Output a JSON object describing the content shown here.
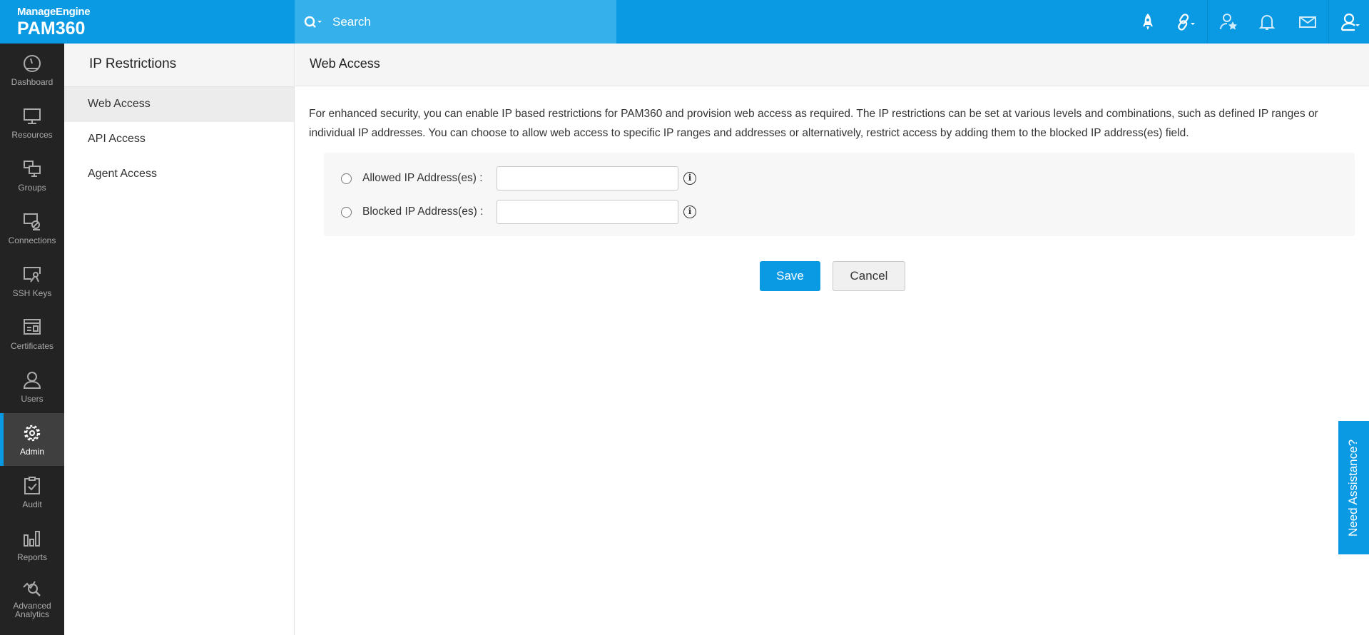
{
  "header": {
    "brand": "ManageEngine",
    "product": "PAM360",
    "search_placeholder": "Search"
  },
  "topbar_icons": [
    "rocket-icon",
    "link-icon",
    "user-star-icon",
    "bell-icon",
    "mail-icon",
    "user-icon"
  ],
  "sidebar": {
    "items": [
      {
        "label": "Dashboard",
        "icon": "dashboard-icon"
      },
      {
        "label": "Resources",
        "icon": "monitor-icon"
      },
      {
        "label": "Groups",
        "icon": "groups-icon"
      },
      {
        "label": "Connections",
        "icon": "connections-icon"
      },
      {
        "label": "SSH Keys",
        "icon": "ssh-key-icon"
      },
      {
        "label": "Certificates",
        "icon": "certificate-icon"
      },
      {
        "label": "Users",
        "icon": "user-icon"
      },
      {
        "label": "Admin",
        "icon": "gear-icon",
        "active": true
      },
      {
        "label": "Audit",
        "icon": "clipboard-check-icon"
      },
      {
        "label": "Reports",
        "icon": "bar-chart-icon"
      },
      {
        "label": "Advanced Analytics",
        "icon": "analytics-icon"
      }
    ]
  },
  "submenu": {
    "title": "IP Restrictions",
    "items": [
      {
        "label": "Web Access",
        "active": true
      },
      {
        "label": "API Access"
      },
      {
        "label": "Agent Access"
      }
    ]
  },
  "main": {
    "title": "Web Access",
    "description": "For enhanced security, you can enable IP based restrictions for PAM360 and provision web access as required. The IP restrictions can be set at various levels and combinations, such as defined IP ranges or individual IP addresses. You can choose to allow web access to specific IP ranges and addresses or alternatively, restrict access by adding them to the blocked IP address(es) field.",
    "allowed_label": "Allowed IP Address(es) :",
    "allowed_value": "",
    "blocked_label": "Blocked IP Address(es) :",
    "blocked_value": "",
    "save": "Save",
    "cancel": "Cancel"
  },
  "assist": "Need Assistance?",
  "colors": {
    "accent": "#0a9ae3",
    "sidebar": "#232323"
  }
}
